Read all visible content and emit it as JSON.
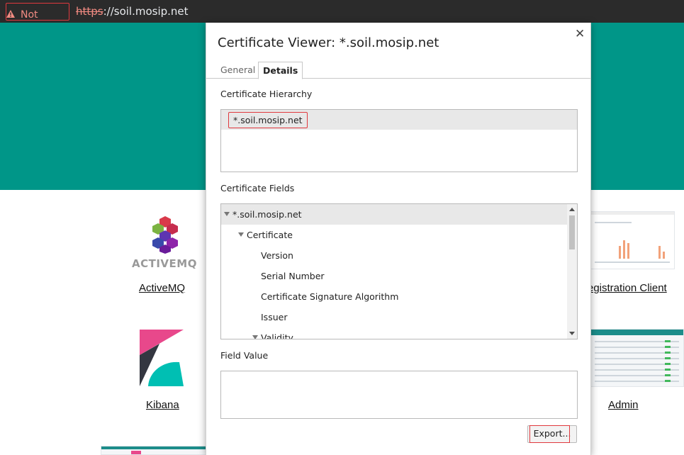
{
  "browser": {
    "security_label": "Not secure",
    "url_scheme": "https",
    "url_rest": "://soil.mosip.net"
  },
  "page": {
    "links": {
      "activemq": "ActiveMQ",
      "kibana": "Kibana",
      "registration_client": "egistration Client",
      "admin": "Admin"
    },
    "activemq_logo_text": "ACTIVEMQ"
  },
  "dialog": {
    "title": "Certificate Viewer: *.soil.mosip.net",
    "tabs": [
      "General",
      "Details"
    ],
    "active_tab": "Details",
    "hierarchy_label": "Certificate Hierarchy",
    "hierarchy_items": [
      "*.soil.mosip.net"
    ],
    "fields_label": "Certificate Fields",
    "fields_tree": [
      {
        "label": "*.soil.mosip.net",
        "expanded": true,
        "selected": true
      },
      {
        "label": "Certificate",
        "expanded": true
      },
      {
        "label": "Version"
      },
      {
        "label": "Serial Number"
      },
      {
        "label": "Certificate Signature Algorithm"
      },
      {
        "label": "Issuer"
      },
      {
        "label": "Validity",
        "expanded": true
      }
    ],
    "field_value_label": "Field Value",
    "field_value": "",
    "export_label": "Export..."
  },
  "colors": {
    "hero": "#009688",
    "warning": "#e0393e",
    "urlbar": "#2b2b2b"
  }
}
